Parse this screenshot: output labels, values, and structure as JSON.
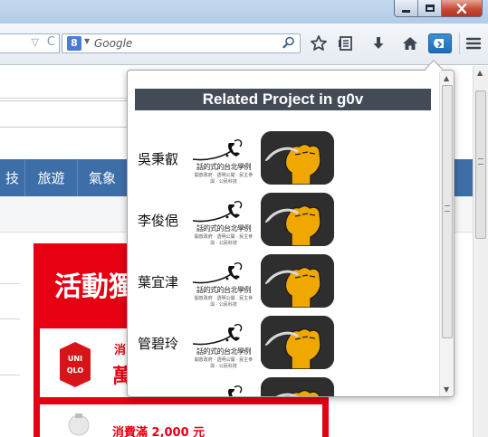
{
  "toolbar": {
    "search_placeholder": "Google",
    "search_engine_letter": "8",
    "icons": [
      "bookmark-star-icon",
      "reading-list-icon",
      "download-icon",
      "home-icon",
      "pocket-icon",
      "menu-icon"
    ]
  },
  "window_controls": [
    "minimize-icon",
    "maximize-icon",
    "close-icon"
  ],
  "page": {
    "nav_items": [
      "技",
      "旅遊",
      "氣象"
    ],
    "promo_title": "活動獨",
    "promo_card1_line1": "消",
    "promo_card1_line2": "萬",
    "promo_card2_text": "消費滿 2,000 元",
    "uniqlo_text": "UNIQLO",
    "brand_color": "#e60012",
    "nav_color": "#3e6ea8"
  },
  "popup": {
    "header": "Related Project in g0v",
    "header_bg": "#434b57",
    "rows": [
      {
        "name": "吳秉叡",
        "logo_caption": "話的式的台北學例",
        "logo_subcaption": "開放政府 · 透明公開 · 民主參與 · 公民科技"
      },
      {
        "name": "李俊俋",
        "logo_caption": "話的式的台北學例",
        "logo_subcaption": "開放政府 · 透明公開 · 民主參與 · 公民科技"
      },
      {
        "name": "葉宜津",
        "logo_caption": "話的式的台北學例",
        "logo_subcaption": "開放政府 · 透明公開 · 民主參與 · 公民科技"
      },
      {
        "name": "管碧玲",
        "logo_caption": "話的式的台北學例",
        "logo_subcaption": "開放政府 · 透明公開 · 民主參與 · 公民科技"
      },
      {
        "name": "",
        "logo_caption": "",
        "logo_subcaption": ""
      }
    ]
  }
}
